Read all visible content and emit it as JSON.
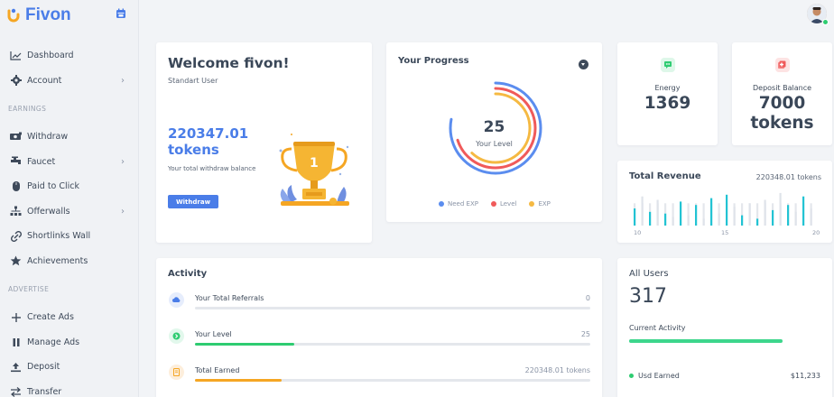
{
  "brand": {
    "name": "Fivon",
    "color": "#4a7de8"
  },
  "sidebar": {
    "items": [
      {
        "label": "Dashboard",
        "icon": "chart-line-icon",
        "chevron": false
      },
      {
        "label": "Account",
        "icon": "gear-icon",
        "chevron": true
      },
      {
        "section": "EARNINGS"
      },
      {
        "label": "Withdraw",
        "icon": "money-icon",
        "chevron": false
      },
      {
        "label": "Faucet",
        "icon": "faucet-icon",
        "chevron": true
      },
      {
        "label": "Paid to Click",
        "icon": "mouse-icon",
        "chevron": false
      },
      {
        "label": "Offerwalls",
        "icon": "sitemap-icon",
        "chevron": true
      },
      {
        "label": "Shortlinks Wall",
        "icon": "link-icon",
        "chevron": false
      },
      {
        "label": "Achievements",
        "icon": "star-icon",
        "chevron": false
      },
      {
        "section": "ADVERTISE"
      },
      {
        "label": "Create Ads",
        "icon": "plus-icon",
        "chevron": false
      },
      {
        "label": "Manage Ads",
        "icon": "pause-icon",
        "chevron": false
      },
      {
        "label": "Deposit",
        "icon": "upload-icon",
        "chevron": false
      },
      {
        "label": "Transfer",
        "icon": "transfer-icon",
        "chevron": false
      }
    ]
  },
  "welcome": {
    "title": "Welcome fivon!",
    "subtitle": "Standart User",
    "amount": "220347.01",
    "amount_unit": "tokens",
    "description": "Your total withdraw balance",
    "button": "Withdraw"
  },
  "progress": {
    "title": "Your Progress",
    "level_value": "25",
    "level_label": "Your Level",
    "rings": [
      {
        "name": "Need EXP",
        "color": "#5b8def",
        "fraction": 0.78
      },
      {
        "name": "Level",
        "color": "#f05a5a",
        "fraction": 0.7
      },
      {
        "name": "EXP",
        "color": "#f5b942",
        "fraction": 0.62
      }
    ]
  },
  "stats": {
    "energy": {
      "label": "Energy",
      "value": "1369",
      "color": "#2ecc71",
      "icon": "chat-icon"
    },
    "deposit": {
      "label": "Deposit Balance",
      "value_line1": "7000",
      "value_line2": "tokens",
      "color": "#f05a5a",
      "icon": "plus-square-icon"
    }
  },
  "revenue": {
    "title": "Total Revenue",
    "amount": "220348.01 tokens",
    "ticks": [
      "10",
      "15",
      "20"
    ],
    "bars": [
      0.5,
      0.85,
      0.4,
      0.75,
      0.35,
      0.25,
      0.7,
      0.3,
      0.6,
      0.2,
      0.8,
      0.35,
      0.9,
      0.55,
      0.3,
      0.65,
      0.2,
      0.75,
      0.45,
      0.95,
      0.6,
      0.4,
      0.85,
      0.5
    ],
    "bar_fill_color": "#22c3d3"
  },
  "activity": {
    "title": "Activity",
    "rows": [
      {
        "label": "Your Total Referrals",
        "value": "0",
        "progress": 0,
        "color": "#4a7de8",
        "icon": "cloud-icon",
        "bg": "#e6edfc"
      },
      {
        "label": "Your Level",
        "value": "25",
        "progress": 0.25,
        "color": "#2ecc71",
        "icon": "level-icon",
        "bg": "#e2f8ec"
      },
      {
        "label": "Total Earned",
        "value": "220348.01 tokens",
        "progress": 0.22,
        "color": "#f5a623",
        "icon": "receipt-icon",
        "bg": "#fdeedb"
      }
    ]
  },
  "users": {
    "title": "All Users",
    "value": "317",
    "activity_label": "Current Activity",
    "activity_progress": 1.0,
    "rows": [
      {
        "label": "Usd Earned",
        "value": "$11,233",
        "color": "#2ecc71"
      }
    ]
  }
}
